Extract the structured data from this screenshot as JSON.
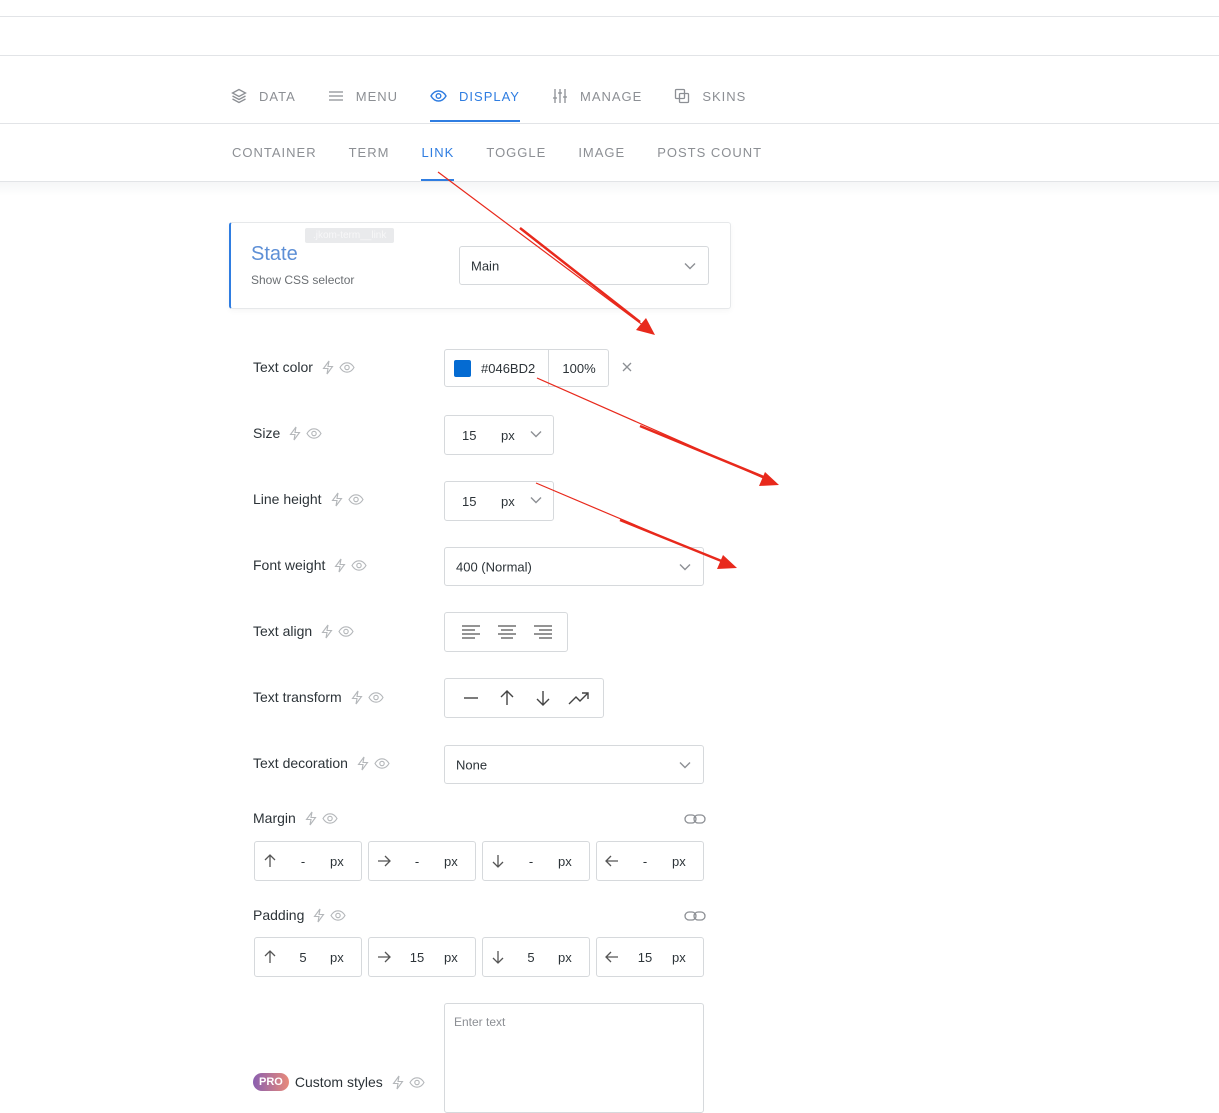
{
  "tabs": [
    {
      "label": "DATA",
      "icon": "layers-icon"
    },
    {
      "label": "MENU",
      "icon": "menu-lines-icon"
    },
    {
      "label": "DISPLAY",
      "icon": "eye-icon",
      "active": true
    },
    {
      "label": "MANAGE",
      "icon": "sliders-icon"
    },
    {
      "label": "SKINS",
      "icon": "copy-icon"
    }
  ],
  "subtabs": [
    "CONTAINER",
    "TERM",
    "LINK",
    "TOGGLE",
    "IMAGE",
    "POSTS COUNT"
  ],
  "active_subtab": "LINK",
  "state": {
    "title": "State",
    "show_selector": "Show CSS selector",
    "selector_badge": ".jkom-term__link",
    "value": "Main"
  },
  "controls": {
    "text_color": {
      "label": "Text color",
      "hex": "#046BD2",
      "opacity": "100%"
    },
    "size": {
      "label": "Size",
      "value": "15",
      "unit": "px"
    },
    "line_height": {
      "label": "Line height",
      "value": "15",
      "unit": "px"
    },
    "font_weight": {
      "label": "Font weight",
      "value": "400 (Normal)"
    },
    "text_align": {
      "label": "Text align"
    },
    "text_transform": {
      "label": "Text transform"
    },
    "text_decoration": {
      "label": "Text decoration",
      "value": "None"
    },
    "margin": {
      "label": "Margin",
      "top": "-",
      "right": "-",
      "bottom": "-",
      "left": "-",
      "unit": "px"
    },
    "padding": {
      "label": "Padding",
      "top": "5",
      "right": "15",
      "bottom": "5",
      "left": "15",
      "unit": "px"
    },
    "custom_styles": {
      "badge": "PRO",
      "label": "Custom styles",
      "placeholder": "Enter text"
    }
  },
  "colors": {
    "accent": "#2f7de1",
    "swatch": "#046bd2",
    "annotation": "#e8291c"
  }
}
